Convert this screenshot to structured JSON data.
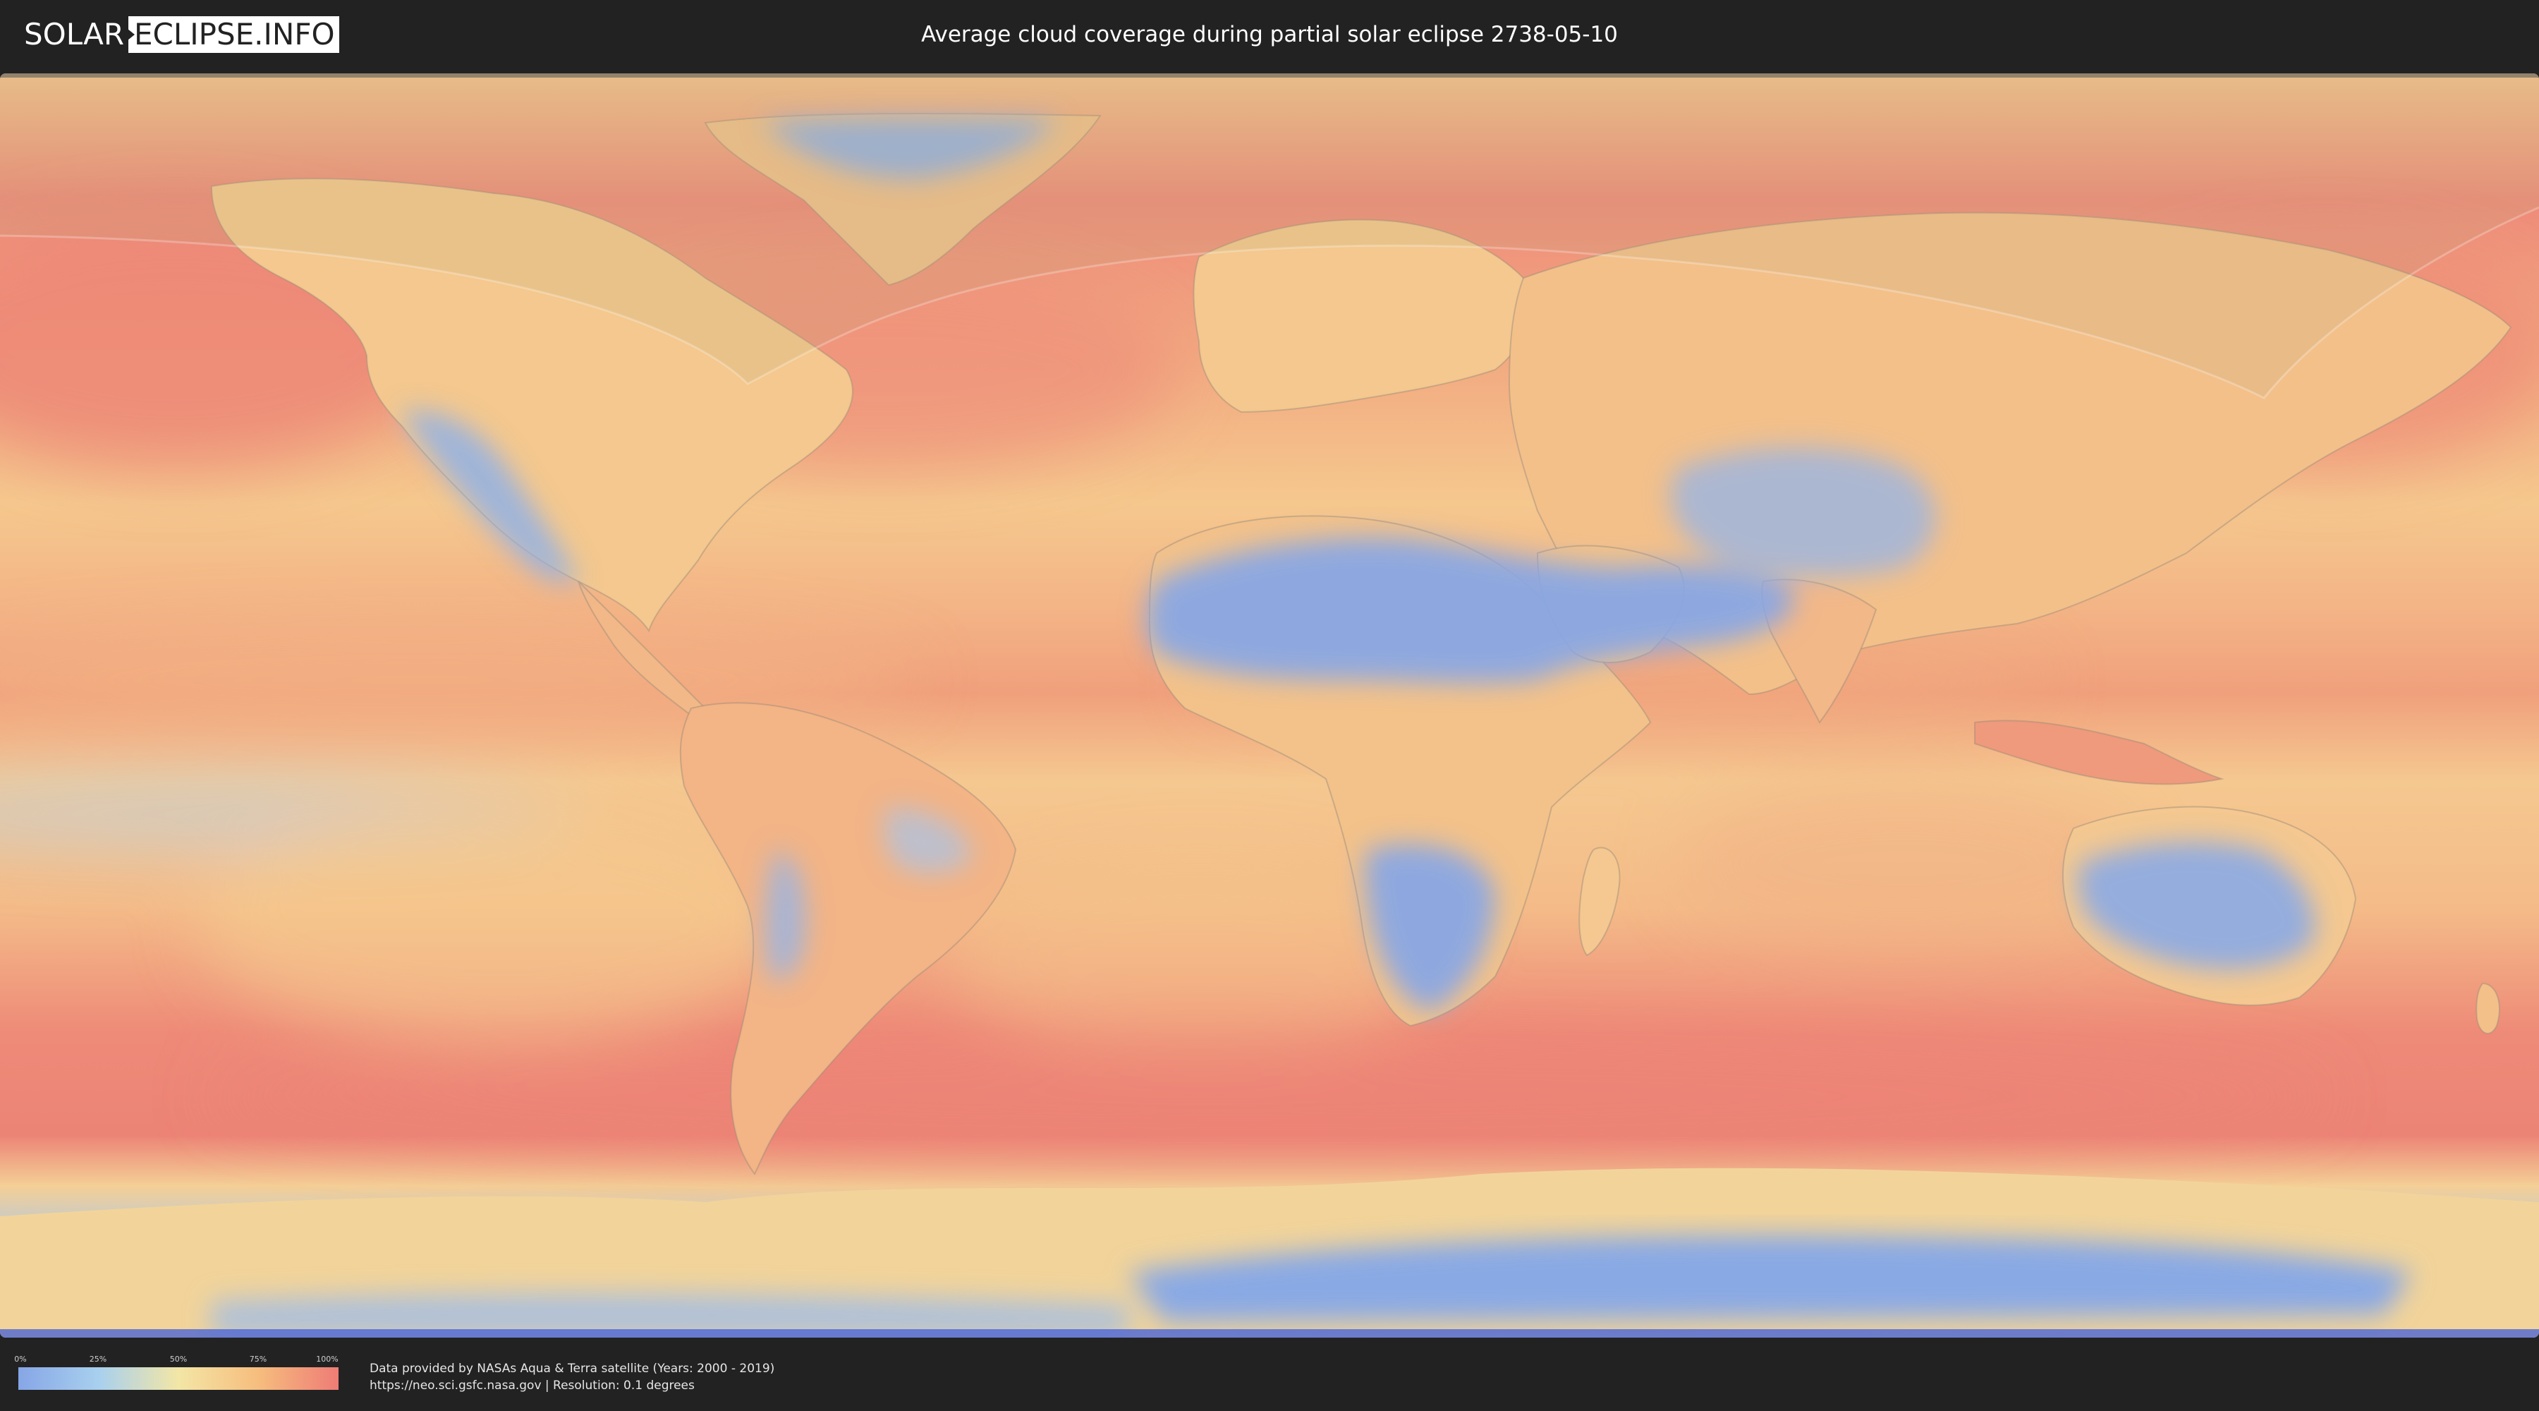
{
  "header": {
    "logo_left": "SOLAR",
    "logo_right": "ECLIPSE.INFO",
    "title": "Average cloud coverage during partial solar eclipse 2738-05-10"
  },
  "legend": {
    "ticks": [
      "0%",
      "25%",
      "50%",
      "75%",
      "100%"
    ],
    "colors": [
      "#86a6e6",
      "#a8d0ee",
      "#f3e6a6",
      "#f6bd7e",
      "#ee7c76"
    ]
  },
  "credits": {
    "line1": "Data provided by NASAs Aqua & Terra satellite (Years: 2000 - 2019)",
    "line2": "https://neo.sci.gsfc.nasa.gov | Resolution: 0.1 degrees"
  },
  "map": {
    "ocean_color": "#ec8a78",
    "eclipse_shadow_color": "#b8a87a",
    "low_cloud_color": "#8fb0e6",
    "mid_cloud_color": "#f3d898"
  }
}
